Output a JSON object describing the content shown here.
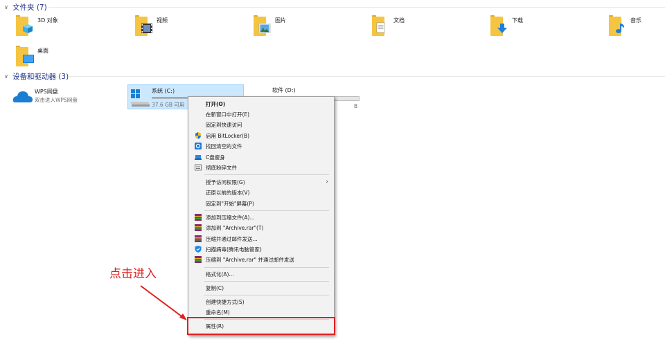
{
  "groups": {
    "folders_header": "文件夹 (7)",
    "devices_header": "设备和驱动器 (3)"
  },
  "folders": [
    {
      "label": "3D 对象",
      "icon": "3d-objects-icon"
    },
    {
      "label": "视频",
      "icon": "video-folder-icon"
    },
    {
      "label": "图片",
      "icon": "pictures-folder-icon"
    },
    {
      "label": "文档",
      "icon": "documents-folder-icon"
    },
    {
      "label": "下载",
      "icon": "downloads-folder-icon"
    },
    {
      "label": "音乐",
      "icon": "music-folder-icon"
    },
    {
      "label": "桌面",
      "icon": "desktop-folder-icon"
    }
  ],
  "devices": {
    "wps": {
      "name": "WPS网盘",
      "sub": "双击进入WPS网盘"
    },
    "c": {
      "name": "系统 (C:)",
      "free": "37.6 GB 可用",
      "used_fraction": 0.6
    },
    "d": {
      "name": "软件 (D:)",
      "free_suffix": "B",
      "used_fraction": 0.4
    }
  },
  "menu": {
    "open": "打开(O)",
    "open_new_window": "在新窗口中打开(E)",
    "pin_quick_access": "固定到快速访问",
    "bitlocker": "启用 BitLocker(B)",
    "recover_files": "找回清空的文件",
    "c_slim": "C盘瘦身",
    "shred": "彻底粉碎文件",
    "grant_access": "授予访问权限(G)",
    "restore_versions": "还原以前的版本(V)",
    "pin_start": "固定到\"开始\"屏幕(P)",
    "add_archive": "添加到压缩文件(A)...",
    "add_archive_rar": "添加到 \"Archive.rar\"(T)",
    "compress_email": "压缩并通过邮件发送...",
    "virus_scan": "扫描病毒(腾讯电脑管家)",
    "compress_rar_email": "压缩到 \"Archive.rar\" 并通过邮件发送",
    "format": "格式化(A)...",
    "copy": "复制(C)",
    "create_shortcut": "创建快捷方式(S)",
    "rename": "重命名(M)",
    "properties": "属性(R)"
  },
  "annotation": {
    "text": "点击进入",
    "color": "#e02020"
  },
  "colors": {
    "accent": "#26a0da",
    "selection": "#cce8ff",
    "header_text": "#1e3287"
  }
}
